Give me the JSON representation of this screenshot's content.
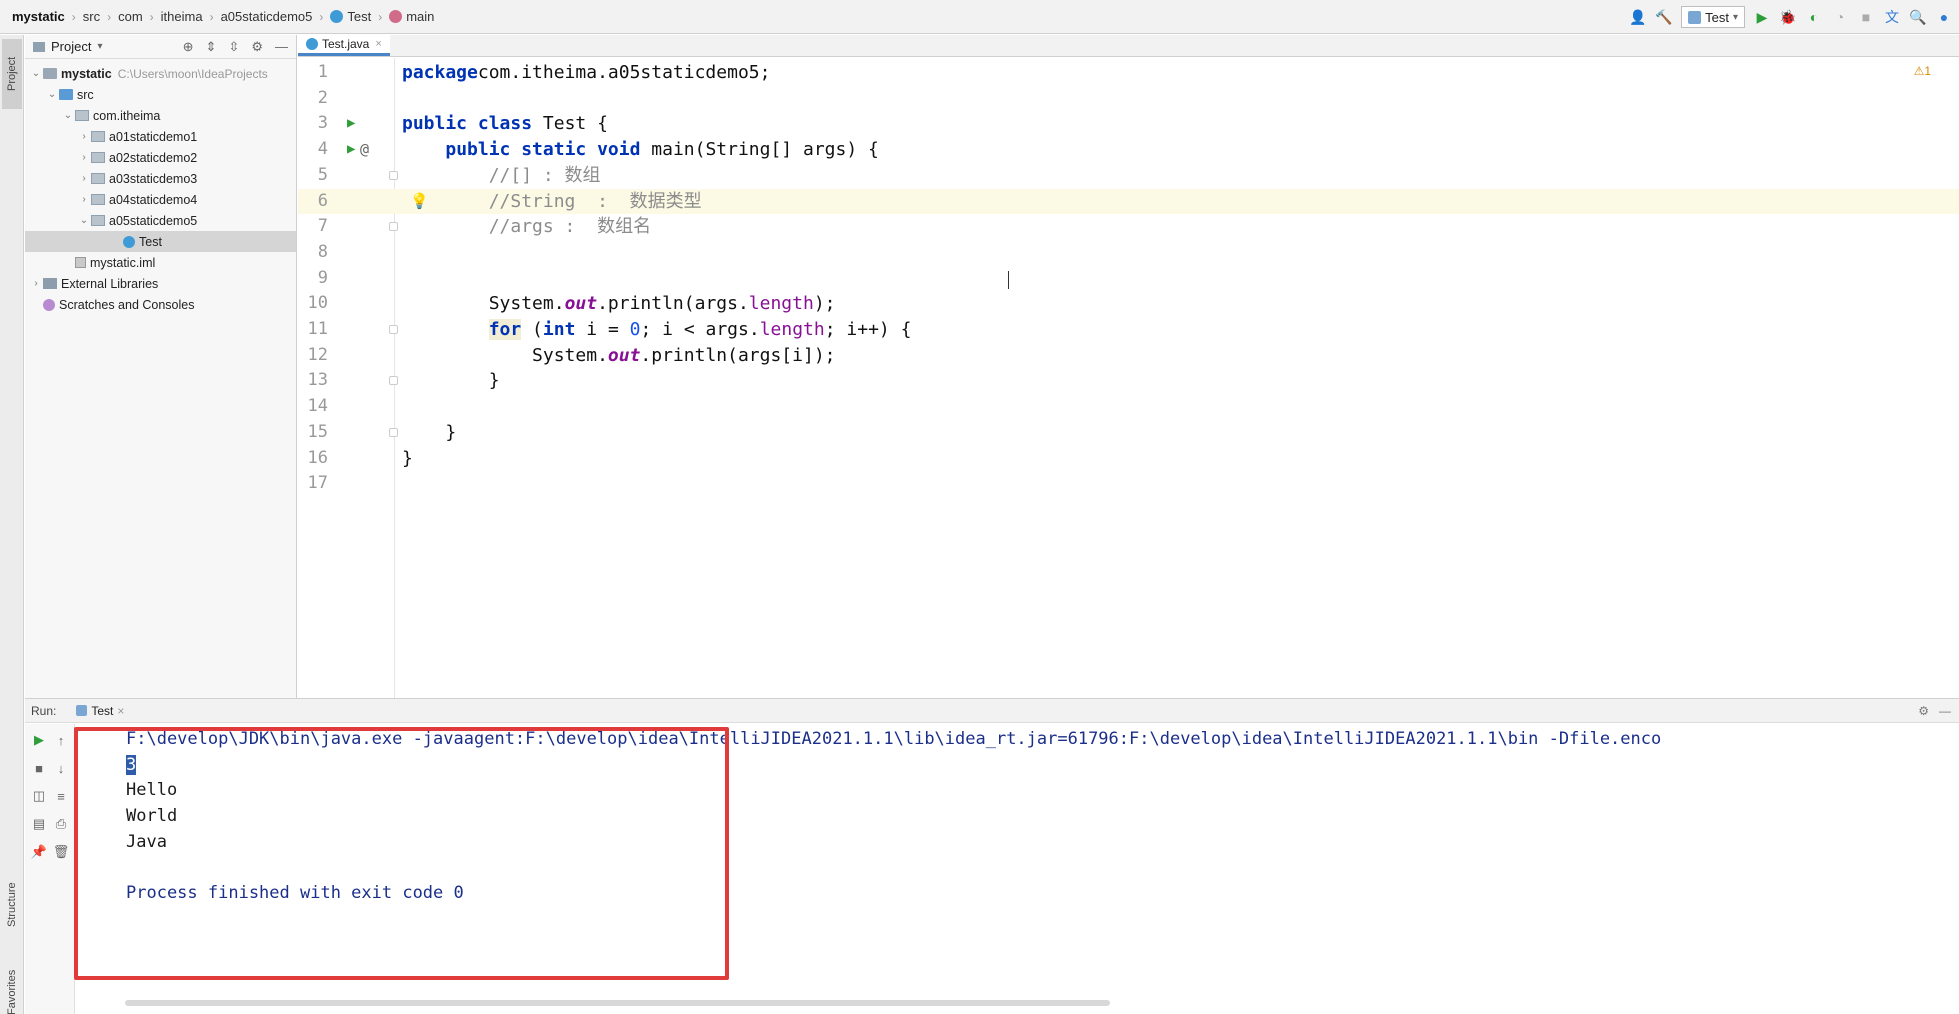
{
  "breadcrumbs": [
    "mystatic",
    "src",
    "com",
    "itheima",
    "a05staticdemo5",
    "Test",
    "main"
  ],
  "toolbar": {
    "run_config": "Test"
  },
  "side_tabs": {
    "project": "Project",
    "structure": "Structure",
    "favorites": "Favorites"
  },
  "project_panel": {
    "title": "Project",
    "tree": [
      {
        "label": "mystatic",
        "hint": "C:\\Users\\moon\\IdeaProjects",
        "icon": "folder",
        "indent": 0,
        "arrow": "down"
      },
      {
        "label": "src",
        "icon": "src",
        "indent": 1,
        "arrow": "down"
      },
      {
        "label": "com.itheima",
        "icon": "pkg",
        "indent": 2,
        "arrow": "down"
      },
      {
        "label": "a01staticdemo1",
        "icon": "pkg",
        "indent": 3,
        "arrow": "right"
      },
      {
        "label": "a02staticdemo2",
        "icon": "pkg",
        "indent": 3,
        "arrow": "right"
      },
      {
        "label": "a03staticdemo3",
        "icon": "pkg",
        "indent": 3,
        "arrow": "right"
      },
      {
        "label": "a04staticdemo4",
        "icon": "pkg",
        "indent": 3,
        "arrow": "right"
      },
      {
        "label": "a05staticdemo5",
        "icon": "pkg",
        "indent": 3,
        "arrow": "down"
      },
      {
        "label": "Test",
        "icon": "cls",
        "indent": 5,
        "arrow": "",
        "selected": true
      },
      {
        "label": "mystatic.iml",
        "icon": "iml",
        "indent": 2,
        "arrow": ""
      },
      {
        "label": "External Libraries",
        "icon": "lib",
        "indent": 0,
        "arrow": "right"
      },
      {
        "label": "Scratches and Consoles",
        "icon": "scr",
        "indent": 0,
        "arrow": ""
      }
    ]
  },
  "editor": {
    "tab_label": "Test.java",
    "inspection": "⚠1",
    "current_line": 6
  },
  "code_lines": [
    {
      "n": "1",
      "segs": [
        [
          "kw",
          "package"
        ],
        [
          "",
          "com.itheima.a05staticdemo5;"
        ]
      ]
    },
    {
      "n": "2",
      "segs": []
    },
    {
      "n": "3",
      "run": true,
      "segs": [
        [
          "kw",
          "public class "
        ],
        [
          "",
          "Test {"
        ]
      ]
    },
    {
      "n": "4",
      "run": true,
      "at": true,
      "segs": [
        [
          "",
          "    "
        ],
        [
          "kw",
          "public static void "
        ],
        [
          "",
          "main(String[] args) {"
        ]
      ]
    },
    {
      "n": "5",
      "fold": true,
      "segs": [
        [
          "",
          "        "
        ],
        [
          "cm",
          "//[] : 数组"
        ]
      ]
    },
    {
      "n": "6",
      "bulb": true,
      "segs": [
        [
          "",
          "        "
        ],
        [
          "cm",
          "//String  :  数据类型"
        ]
      ]
    },
    {
      "n": "7",
      "fold": true,
      "segs": [
        [
          "",
          "        "
        ],
        [
          "cm",
          "//args :  数组名"
        ]
      ]
    },
    {
      "n": "8",
      "segs": []
    },
    {
      "n": "9",
      "segs": []
    },
    {
      "n": "10",
      "segs": [
        [
          "",
          "        System."
        ],
        [
          "fld",
          "out"
        ],
        [
          "",
          ".println(args."
        ],
        [
          "prop",
          "length"
        ],
        [
          "",
          ");"
        ]
      ]
    },
    {
      "n": "11",
      "fold": true,
      "segs": [
        [
          "",
          "        "
        ],
        [
          "kwfor",
          "for"
        ],
        [
          "",
          " ("
        ],
        [
          "kw",
          "int "
        ],
        [
          "",
          "i = "
        ],
        [
          "num",
          "0"
        ],
        [
          "",
          "; i < args."
        ],
        [
          "prop",
          "length"
        ],
        [
          "",
          "; i++) {"
        ]
      ]
    },
    {
      "n": "12",
      "segs": [
        [
          "",
          "            System."
        ],
        [
          "fld",
          "out"
        ],
        [
          "",
          ".println(args[i]);"
        ]
      ]
    },
    {
      "n": "13",
      "fold": true,
      "segs": [
        [
          "",
          "        }"
        ]
      ]
    },
    {
      "n": "14",
      "segs": []
    },
    {
      "n": "15",
      "fold": true,
      "segs": [
        [
          "",
          "    }"
        ]
      ]
    },
    {
      "n": "16",
      "segs": [
        [
          "",
          "}"
        ]
      ]
    },
    {
      "n": "17",
      "segs": []
    }
  ],
  "run_panel": {
    "label": "Run:",
    "tab_label": "Test",
    "command": "F:\\develop\\JDK\\bin\\java.exe -javaagent:F:\\develop\\idea\\IntelliJIDEA2021.1.1\\lib\\idea_rt.jar=61796:F:\\develop\\idea\\IntelliJIDEA2021.1.1\\bin -Dfile.enco",
    "output": [
      "3",
      "Hello",
      "World",
      "Java"
    ],
    "exit_message": "Process finished with exit code 0"
  },
  "colors": {
    "keyword": "#0033b3",
    "comment": "#8c8c8c",
    "highlight_box": "#e03a3a",
    "selection": "#2f5ba8"
  }
}
